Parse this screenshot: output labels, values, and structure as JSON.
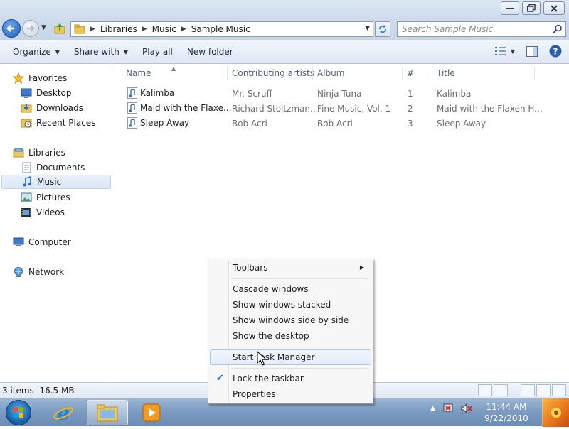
{
  "window": {
    "caption_buttons": [
      "minimize-icon",
      "maximize-icon",
      "close-icon"
    ]
  },
  "address": {
    "breadcrumbs": [
      "Libraries",
      "Music",
      "Sample Music"
    ],
    "search_placeholder": "Search Sample Music"
  },
  "toolbar": {
    "organize": "Organize",
    "share_with": "Share with",
    "play_all": "Play all",
    "new_folder": "New folder"
  },
  "nav": {
    "favorites": "Favorites",
    "desktop": "Desktop",
    "downloads": "Downloads",
    "recent_places": "Recent Places",
    "libraries": "Libraries",
    "documents": "Documents",
    "music": "Music",
    "pictures": "Pictures",
    "videos": "Videos",
    "computer": "Computer",
    "network": "Network"
  },
  "columns": {
    "name": "Name",
    "artists": "Contributing artists",
    "album": "Album",
    "number": "#",
    "title": "Title"
  },
  "files": [
    {
      "name": "Kalimba",
      "artists": "Mr. Scruff",
      "album": "Ninja Tuna",
      "number": "1",
      "title": "Kalimba"
    },
    {
      "name": "Maid with the Flaxe...",
      "artists": "Richard Stoltzman...",
      "album": "Fine Music, Vol. 1",
      "number": "2",
      "title": "Maid with the Flaxen H..."
    },
    {
      "name": "Sleep Away",
      "artists": "Bob Acri",
      "album": "Bob Acri",
      "number": "3",
      "title": "Sleep Away"
    }
  ],
  "status": {
    "summary": "3 items  16.5 MB"
  },
  "context_menu": {
    "toolbars": "Toolbars",
    "cascade": "Cascade windows",
    "stacked": "Show windows stacked",
    "side_by_side": "Show windows side by side",
    "show_desktop": "Show the desktop",
    "task_manager": "Start Task Manager",
    "lock_taskbar": "Lock the taskbar",
    "properties": "Properties",
    "lock_checked": true
  },
  "taskbar": {
    "time": "11:44 AM",
    "date": "9/22/2010"
  },
  "colors": {
    "accent": "#1d5fb8",
    "taskbar": "#7d9cc3",
    "menu_hover_border": "#a8c8ee"
  }
}
